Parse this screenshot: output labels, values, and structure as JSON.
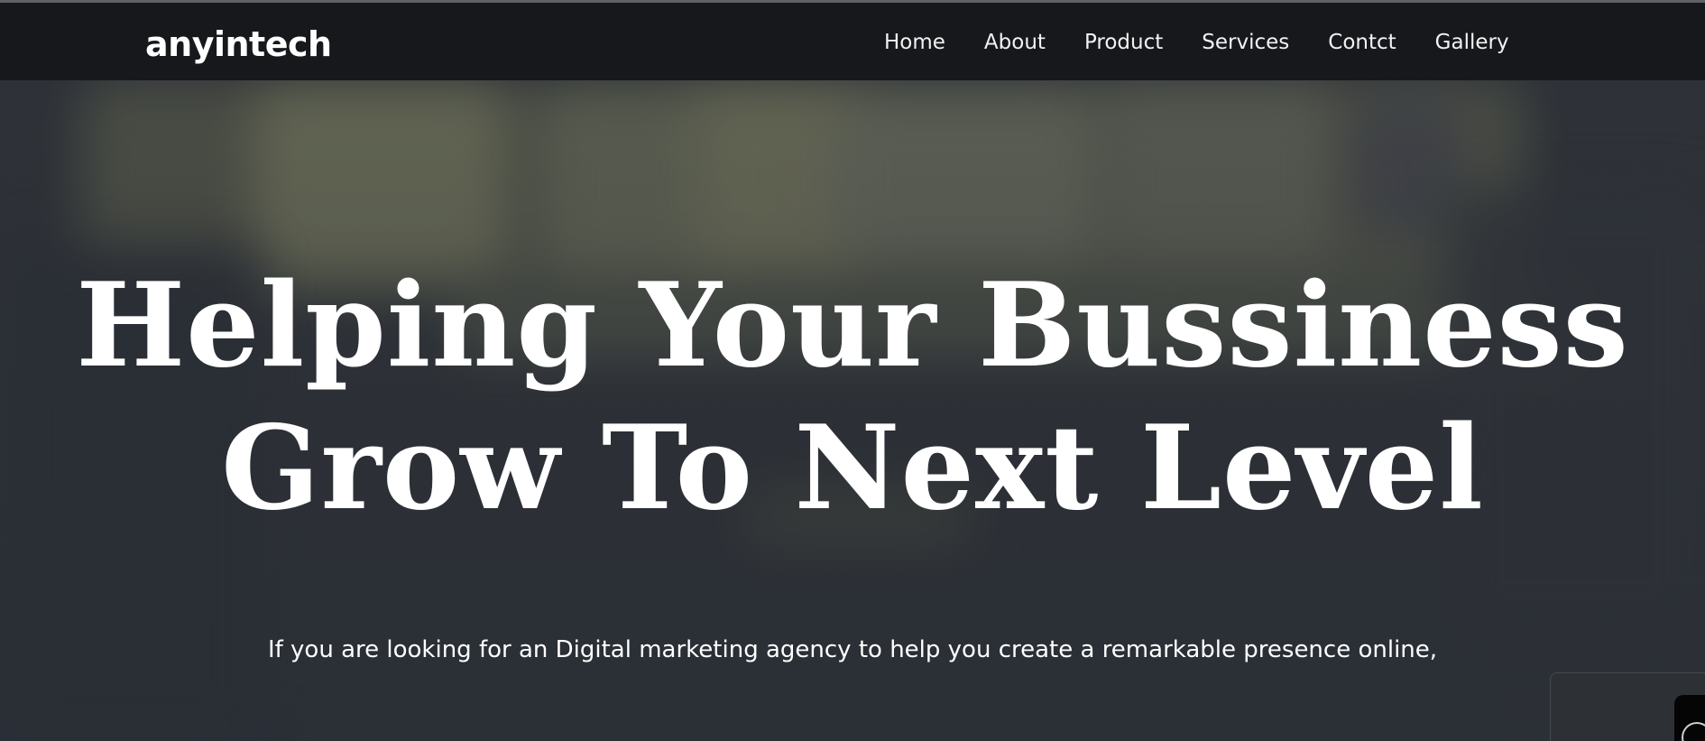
{
  "brand": {
    "name": "anyintech"
  },
  "nav": {
    "items": [
      {
        "label": "Home"
      },
      {
        "label": "About"
      },
      {
        "label": "Product"
      },
      {
        "label": "Services"
      },
      {
        "label": "Contct"
      },
      {
        "label": "Gallery"
      }
    ]
  },
  "hero": {
    "headline_line1": "Helping Your Bussiness",
    "headline_line2": "Grow To Next Level",
    "subtext": "If you are looking for an Digital marketing agency to help you create a remarkable presence online,"
  },
  "colors": {
    "navbar_bg": "#16181c",
    "text": "#ffffff",
    "hero_bg": "#2e3238"
  },
  "icons": {
    "widget": "chat-widget-icon"
  }
}
